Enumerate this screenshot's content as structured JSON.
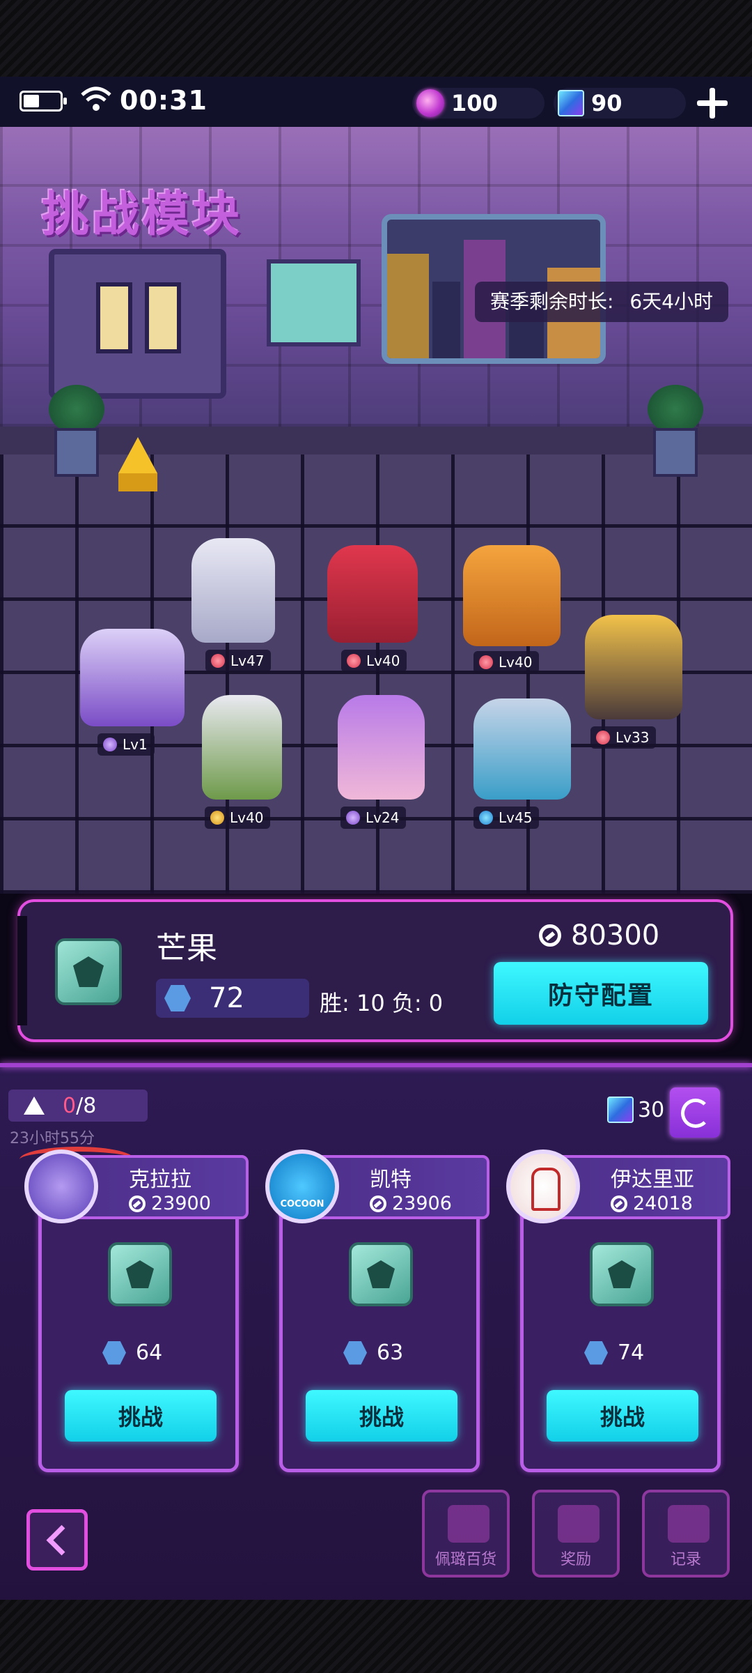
{
  "status": {
    "time": "00:31",
    "gems": "100",
    "cubes": "90"
  },
  "scene": {
    "title_art": "挑战模块",
    "season_label": "赛季剩余时长:",
    "season_value": "6天4小时",
    "characters": [
      {
        "level": "Lv47",
        "class_icon": "fire-icon",
        "color": "#d8d8e8"
      },
      {
        "level": "Lv40",
        "class_icon": "fire-icon",
        "color": "#d8384a"
      },
      {
        "level": "Lv40",
        "class_icon": "fire-icon",
        "color": "#f29a3a"
      },
      {
        "level": "Lv1",
        "class_icon": "void-icon",
        "color": "#c7b4f0"
      },
      {
        "level": "Lv33",
        "class_icon": "fire-icon",
        "color": "#e8b23a"
      },
      {
        "level": "Lv40",
        "class_icon": "mountain-icon",
        "color": "#6fbf5a"
      },
      {
        "level": "Lv24",
        "class_icon": "void-icon",
        "color": "#b77ae6"
      },
      {
        "level": "Lv45",
        "class_icon": "swirl-icon",
        "color": "#a9d8ec"
      }
    ]
  },
  "player": {
    "name": "芒果",
    "rank": "72",
    "record": "胜: 10 负: 0",
    "score": "80300",
    "defend_label": "防守配置"
  },
  "challenge": {
    "attempts_current": "0",
    "attempts_total": "/8",
    "timer": "23小时55分",
    "refresh_cost": "30",
    "opponents": [
      {
        "name": "克拉拉",
        "score": "23900",
        "rank": "64",
        "button": "挑战",
        "avatar_color": "#6a4fd0"
      },
      {
        "name": "凯特",
        "score": "23906",
        "rank": "63",
        "button": "挑战",
        "avatar_color": "#1e9ad8",
        "avatar_text": "COCOON"
      },
      {
        "name": "伊达里亚",
        "score": "24018",
        "rank": "74",
        "button": "挑战",
        "avatar_color": "#ffffff"
      }
    ]
  },
  "nav": {
    "shop_label": "佩璐百货",
    "reward_label": "奖励",
    "record_label": "记录"
  },
  "colors": {
    "accent_magenta": "#e24fe0",
    "button_cyan": "#3ff8ff",
    "loss_red": "#ff5a8a"
  }
}
